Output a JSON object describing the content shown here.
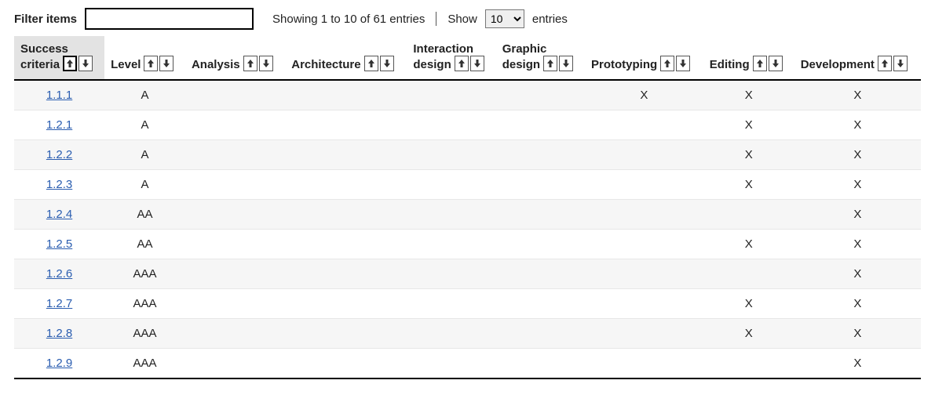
{
  "filter": {
    "label": "Filter items",
    "value": ""
  },
  "status": {
    "showing_text": "Showing 1 to 10 of 61 entries",
    "show_label_before": "Show",
    "show_label_after": "entries",
    "show_selected": "10",
    "show_options": [
      "10",
      "25",
      "50",
      "100"
    ]
  },
  "columns": [
    {
      "key": "success_criteria",
      "label": "Success criteria",
      "multiline": true,
      "sorted_asc": true
    },
    {
      "key": "level",
      "label": "Level"
    },
    {
      "key": "analysis",
      "label": "Analysis"
    },
    {
      "key": "architecture",
      "label": "Architecture"
    },
    {
      "key": "interaction_design",
      "label": "Interaction design",
      "multiline": true
    },
    {
      "key": "graphic_design",
      "label": "Graphic design",
      "multiline": true
    },
    {
      "key": "prototyping",
      "label": "Prototyping"
    },
    {
      "key": "editing",
      "label": "Editing"
    },
    {
      "key": "development",
      "label": "Development"
    }
  ],
  "rows": [
    {
      "success_criteria": "1.1.1",
      "level": "A",
      "analysis": "",
      "architecture": "",
      "interaction_design": "",
      "graphic_design": "",
      "prototyping": "X",
      "editing": "X",
      "development": "X"
    },
    {
      "success_criteria": "1.2.1",
      "level": "A",
      "analysis": "",
      "architecture": "",
      "interaction_design": "",
      "graphic_design": "",
      "prototyping": "",
      "editing": "X",
      "development": "X"
    },
    {
      "success_criteria": "1.2.2",
      "level": "A",
      "analysis": "",
      "architecture": "",
      "interaction_design": "",
      "graphic_design": "",
      "prototyping": "",
      "editing": "X",
      "development": "X"
    },
    {
      "success_criteria": "1.2.3",
      "level": "A",
      "analysis": "",
      "architecture": "",
      "interaction_design": "",
      "graphic_design": "",
      "prototyping": "",
      "editing": "X",
      "development": "X"
    },
    {
      "success_criteria": "1.2.4",
      "level": "AA",
      "analysis": "",
      "architecture": "",
      "interaction_design": "",
      "graphic_design": "",
      "prototyping": "",
      "editing": "",
      "development": "X"
    },
    {
      "success_criteria": "1.2.5",
      "level": "AA",
      "analysis": "",
      "architecture": "",
      "interaction_design": "",
      "graphic_design": "",
      "prototyping": "",
      "editing": "X",
      "development": "X"
    },
    {
      "success_criteria": "1.2.6",
      "level": "AAA",
      "analysis": "",
      "architecture": "",
      "interaction_design": "",
      "graphic_design": "",
      "prototyping": "",
      "editing": "",
      "development": "X"
    },
    {
      "success_criteria": "1.2.7",
      "level": "AAA",
      "analysis": "",
      "architecture": "",
      "interaction_design": "",
      "graphic_design": "",
      "prototyping": "",
      "editing": "X",
      "development": "X"
    },
    {
      "success_criteria": "1.2.8",
      "level": "AAA",
      "analysis": "",
      "architecture": "",
      "interaction_design": "",
      "graphic_design": "",
      "prototyping": "",
      "editing": "X",
      "development": "X"
    },
    {
      "success_criteria": "1.2.9",
      "level": "AAA",
      "analysis": "",
      "architecture": "",
      "interaction_design": "",
      "graphic_design": "",
      "prototyping": "",
      "editing": "",
      "development": "X"
    }
  ]
}
